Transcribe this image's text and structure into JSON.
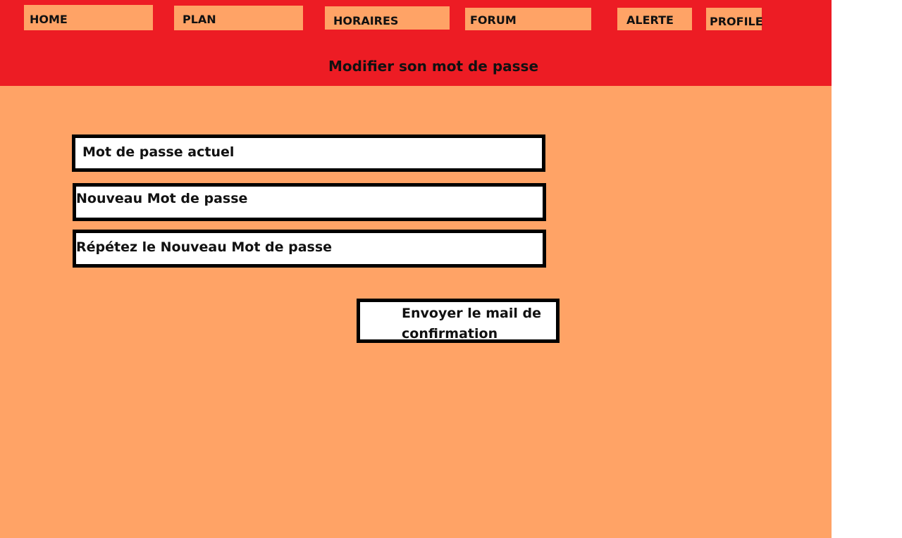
{
  "nav": {
    "home": "HOME",
    "plan": "PLAN",
    "horaires": "HORAIRES",
    "forum": "FORUM",
    "alerte": "ALERTE",
    "profile": "PROFILE"
  },
  "header": {
    "title": "Modifier son mot de passe"
  },
  "form": {
    "current_password": "Mot de passe actuel",
    "new_password": "Nouveau Mot de passe",
    "repeat_password": "Répétez le Nouveau Mot de passe",
    "submit_label": "Envoyer le mail de confirmation"
  },
  "colors": {
    "header_red": "#ed1c24",
    "background_orange": "#ffa366",
    "field_white": "#ffffff",
    "border_black": "#000000"
  }
}
